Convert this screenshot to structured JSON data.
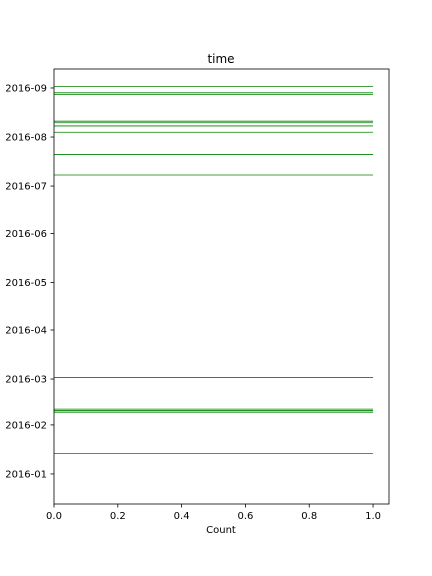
{
  "chart_data": {
    "type": "eventplot",
    "title": "time",
    "xlabel": "Count",
    "ylabel": "",
    "xlim": [
      0,
      1.05
    ],
    "x_ticks": [
      0.0,
      0.2,
      0.4,
      0.6,
      0.8,
      1.0
    ],
    "x_tick_labels": [
      "0.0",
      "0.2",
      "0.4",
      "0.6",
      "0.8",
      "1.0"
    ],
    "ylim": [
      "2015-12-13",
      "2016-09-13"
    ],
    "y_ticks": [
      "2016-01-01",
      "2016-02-01",
      "2016-03-01",
      "2016-04-01",
      "2016-05-01",
      "2016-06-01",
      "2016-07-01",
      "2016-08-01",
      "2016-09-01"
    ],
    "y_tick_labels": [
      "2016-01",
      "2016-02",
      "2016-03",
      "2016-04",
      "2016-05",
      "2016-06",
      "2016-07",
      "2016-08",
      "2016-09"
    ],
    "line_span": [
      0,
      1
    ],
    "line_color": "#008000",
    "events": [
      "2016-01-14",
      "2016-02-09",
      "2016-02-10",
      "2016-02-10",
      "2016-02-11",
      "2016-03-02",
      "2016-07-08",
      "2016-07-21",
      "2016-08-04",
      "2016-08-08",
      "2016-08-10",
      "2016-08-11",
      "2016-08-28",
      "2016-08-29",
      "2016-09-02"
    ],
    "grid": false
  }
}
